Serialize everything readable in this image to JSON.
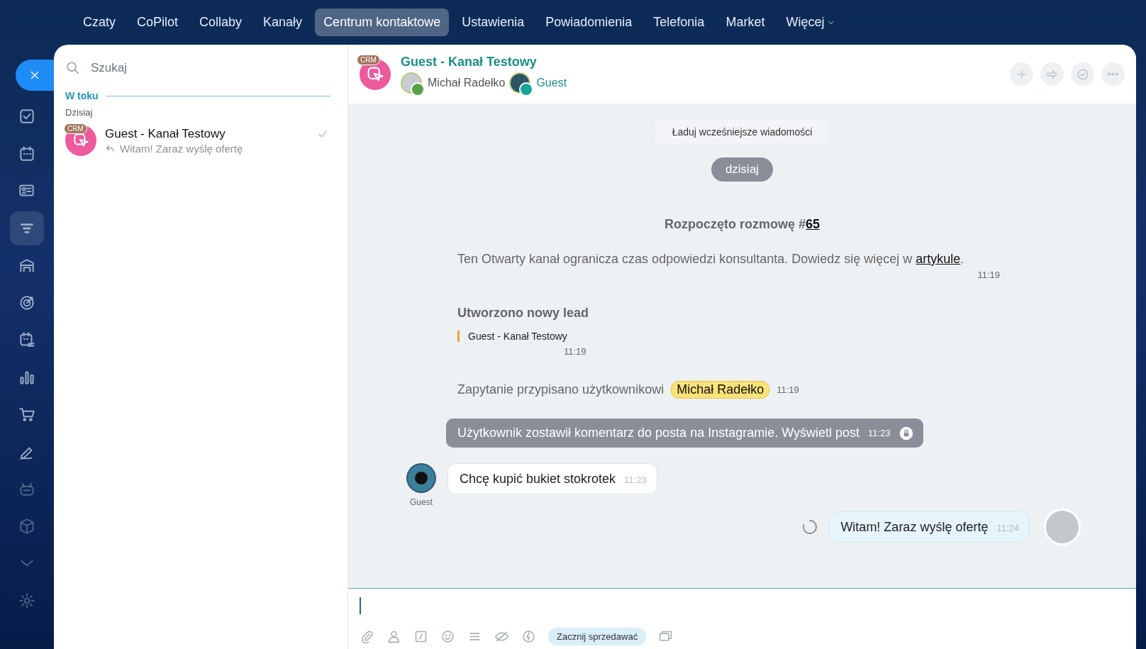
{
  "top_nav": {
    "items": [
      {
        "label": "Czaty",
        "selected": false,
        "kind": "link"
      },
      {
        "label": "CoPilot",
        "selected": false,
        "kind": "link"
      },
      {
        "label": "Collaby",
        "selected": false,
        "kind": "link"
      },
      {
        "label": "Kanały",
        "selected": false,
        "kind": "link"
      },
      {
        "label": "Centrum kontaktowe",
        "selected": true,
        "kind": "link"
      },
      {
        "label": "Ustawienia",
        "selected": false,
        "kind": "link"
      },
      {
        "label": "Powiadomienia",
        "selected": false,
        "kind": "link"
      },
      {
        "label": "Telefonia",
        "selected": false,
        "kind": "link"
      },
      {
        "label": "Market",
        "selected": false,
        "kind": "link"
      },
      {
        "label": "Więcej",
        "selected": false,
        "kind": "dropdown"
      }
    ]
  },
  "sidebar": {
    "items": [
      {
        "kind": "tasks",
        "selected": false
      },
      {
        "kind": "calendar",
        "selected": false
      },
      {
        "kind": "contacts",
        "selected": false
      },
      {
        "kind": "funnel",
        "selected": true
      },
      {
        "kind": "store",
        "selected": false
      },
      {
        "kind": "target",
        "selected": false
      },
      {
        "kind": "schedule",
        "selected": false
      },
      {
        "kind": "chart",
        "selected": false
      },
      {
        "kind": "cart",
        "selected": false
      },
      {
        "kind": "pen",
        "selected": false
      },
      {
        "kind": "robot",
        "selected": false
      },
      {
        "kind": "box",
        "selected": false
      },
      {
        "kind": "chevron",
        "selected": false
      },
      {
        "kind": "gear",
        "selected": false
      }
    ]
  },
  "search": {
    "placeholder": "Szukaj"
  },
  "recent": {
    "section": "W toku",
    "date_group": "Dzisiaj",
    "chats": [
      {
        "badge": "CRM",
        "title": "Guest - Kanał Testowy",
        "last_message": "Witam! Zaraz wyślę ofertę",
        "read": true
      }
    ]
  },
  "chat_header": {
    "badge": "CRM",
    "title": "Guest - Kanał Testowy",
    "participants": [
      {
        "name": "Michał Radełko",
        "kind": "operator"
      },
      {
        "name": "Guest",
        "kind": "guest"
      }
    ]
  },
  "messages": [
    {
      "kind": "load_more",
      "text": "Ładuj wcześniejsze wiadomości"
    },
    {
      "kind": "date",
      "text": "dzisiaj"
    },
    {
      "kind": "system_title",
      "text": "Rozpoczęto rozmowę #",
      "link": "65"
    },
    {
      "kind": "notice",
      "text": "Ten Otwarty kanał ogranicza czas odpowiedzi konsultanta. Dowiedz się więcej w ",
      "link": "artykule",
      "after": ".",
      "time": "11:19"
    },
    {
      "kind": "lead",
      "title": "Utworzono nowy lead",
      "quote": "Guest - Kanał Testowy",
      "time": "11:19"
    },
    {
      "kind": "assigned",
      "text": "Zapytanie przypisano użytkownikowi",
      "user": "Michał Radełko",
      "time": "11:19"
    },
    {
      "kind": "system_bubble",
      "text": "Użytkownik zostawił komentarz do posta na Instagramie.",
      "link": "Wyświetl post",
      "time": "11:23"
    },
    {
      "kind": "incoming",
      "text": "Chcę kupić bukiet stokrotek",
      "time": "11:23",
      "author": "Guest"
    },
    {
      "kind": "outgoing",
      "text": "Witam! Zaraz wyślę ofertę",
      "time": "11:24",
      "pending": true
    }
  ],
  "composer": {
    "sell_button": "Zacznij sprzedawać"
  }
}
